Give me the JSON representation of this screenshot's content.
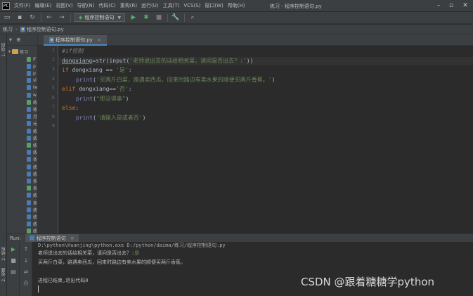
{
  "titlebar": {
    "menu": [
      "文件(F)",
      "编辑(E)",
      "视图(V)",
      "导航(N)",
      "代码(C)",
      "重构(R)",
      "运行(U)",
      "工具(T)",
      "VCS(S)",
      "窗口(W)",
      "帮助(H)"
    ],
    "window_title": "练习 - 程序控制语句.py"
  },
  "toolbar": {
    "run_config": "程序控制语句"
  },
  "navbar": {
    "project": "练习",
    "file": "程序控制语句.py"
  },
  "left_strip": {
    "project_tab": "1: 项目",
    "structure_tab": "2: 结构",
    "favorites_tab": "2: 收藏"
  },
  "project_panel": {
    "root": "练习",
    "items": [
      "if",
      "p",
      "p",
      "sl",
      "te",
      "w",
      "练",
      "练",
      "月",
      "元",
      "练",
      "练",
      "练",
      "练",
      "条",
      "练",
      "练",
      "条",
      "条",
      "练",
      "条",
      "练",
      "练",
      "练",
      "练"
    ]
  },
  "editor": {
    "tab_label": "程序控制语句.py",
    "line_numbers": [
      "1",
      "2",
      "3",
      "4",
      "5",
      "6",
      "7",
      "8",
      "9"
    ],
    "lines": {
      "l1_comment": "#if控制",
      "l2_var": "dongxiang",
      "l2_mid": "=str(input(",
      "l2_str": "'老师说出去的话给相关菜，请问是否出去？:'",
      "l2_end": "))",
      "l3_kw": "if",
      "l3_mid": " dongxiang == ",
      "l3_str": "'是'",
      "l3_end": ":",
      "l4_fn": "print",
      "l4_open": "(",
      "l4_str": "'买两斤白菜，路遇卖西瓜，回来时路边有卖水果的顺便买两斤香蕉。'",
      "l4_end": ")",
      "l5_kw": "elif",
      "l5_mid": " dongxiang==",
      "l5_str": "'否'",
      "l5_end": ":",
      "l6_fn": "print",
      "l6_open": "(",
      "l6_str": "\"那没得事\"",
      "l6_end": ")",
      "l7_kw": "else",
      "l7_end": ":",
      "l8_fn": "print",
      "l8_open": "(",
      "l8_str": "'请输入是或者否'",
      "l8_end": ")"
    }
  },
  "run_panel": {
    "label": "Run:",
    "tab_label": "程序控制语句",
    "console": {
      "cmd": "D:\\python\\Huanjing\\python.exe D:/python/daima/练习/程序控制语句.py",
      "prompt": "老师说出去的话给相关菜，请问是否出去？:",
      "input": "是",
      "output": "买两斤白菜，路遇卖西瓜，回来时路边有卖水果的顺便买两斤香蕉。",
      "exit": "进程已结束,退出代码0"
    }
  },
  "watermark": "CSDN @跟着糖糖学python",
  "colors": {
    "keyword": "#cc7832",
    "string": "#6a8759",
    "builtin": "#8888c6",
    "comment": "#808080",
    "background": "#2b2b2b"
  }
}
